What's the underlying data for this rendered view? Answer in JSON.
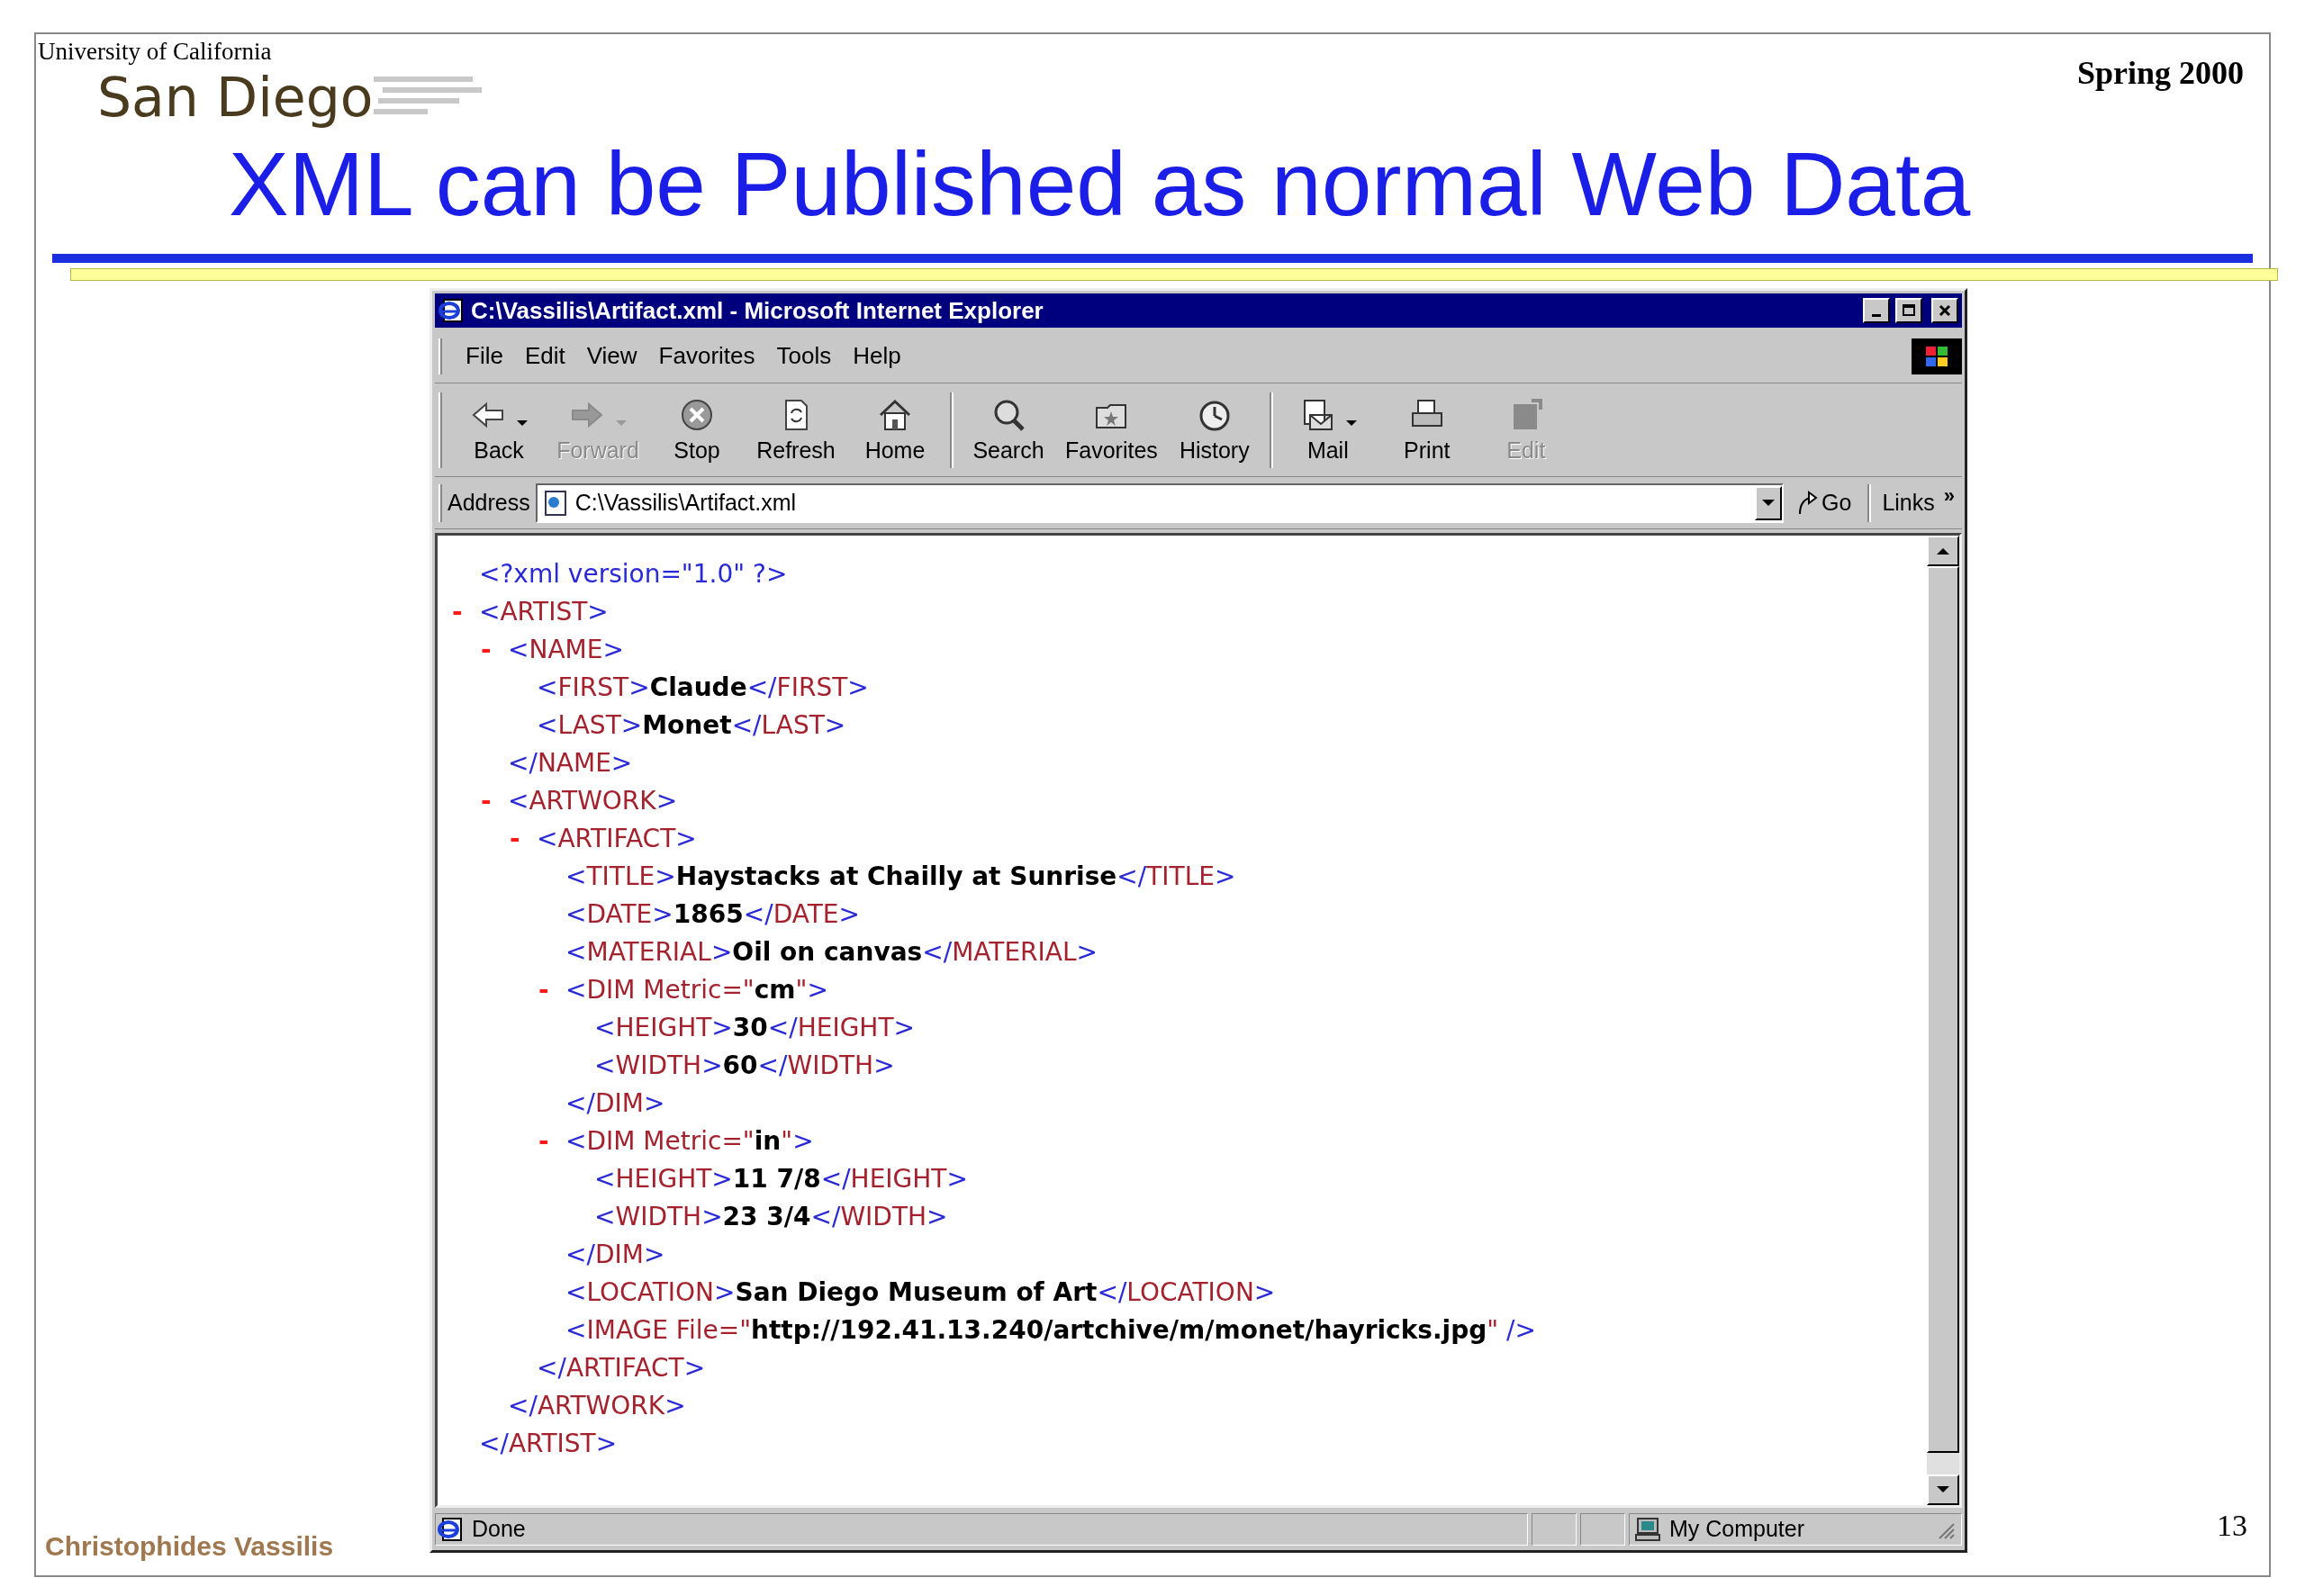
{
  "slide": {
    "institution": "University of California",
    "campus": "San Diego",
    "term": "Spring 2000",
    "title": "XML can be Published as normal Web Data",
    "author": "Christophides Vassilis",
    "page_number": "13"
  },
  "browser": {
    "title": "C:\\Vassilis\\Artifact.xml - Microsoft Internet Explorer",
    "menu": [
      "File",
      "Edit",
      "View",
      "Favorites",
      "Tools",
      "Help"
    ],
    "toolbar": [
      [
        {
          "kind": "back",
          "label": "Back",
          "disabled": false,
          "dropdown": true
        },
        {
          "kind": "forward",
          "label": "Forward",
          "disabled": true,
          "dropdown": true
        },
        {
          "kind": "stop",
          "label": "Stop",
          "disabled": false,
          "dropdown": false
        },
        {
          "kind": "refresh",
          "label": "Refresh",
          "disabled": false,
          "dropdown": false
        },
        {
          "kind": "home",
          "label": "Home",
          "disabled": false,
          "dropdown": false
        }
      ],
      [
        {
          "kind": "search",
          "label": "Search",
          "disabled": false,
          "dropdown": false
        },
        {
          "kind": "favorites",
          "label": "Favorites",
          "disabled": false,
          "dropdown": false
        },
        {
          "kind": "history",
          "label": "History",
          "disabled": false,
          "dropdown": false
        }
      ],
      [
        {
          "kind": "mail",
          "label": "Mail",
          "disabled": false,
          "dropdown": true
        },
        {
          "kind": "print",
          "label": "Print",
          "disabled": false,
          "dropdown": false
        },
        {
          "kind": "edit",
          "label": "Edit",
          "disabled": true,
          "dropdown": false
        }
      ]
    ],
    "address": {
      "label": "Address",
      "value": "C:\\Vassilis\\Artifact.xml",
      "go": "Go",
      "links": "Links",
      "links_more": "»"
    },
    "xml": [
      {
        "parts": [
          {
            "kind": "markup",
            "text": "<?xml version=\"1.0\" ?>"
          }
        ]
      },
      {
        "toggle": "-",
        "expanded": true,
        "open": [
          {
            "kind": "markup",
            "text": "<"
          },
          {
            "kind": "name",
            "text": "ARTIST"
          },
          {
            "kind": "markup",
            "text": ">"
          }
        ],
        "close": [
          {
            "kind": "markup",
            "text": "</"
          },
          {
            "kind": "name",
            "text": "ARTIST"
          },
          {
            "kind": "markup",
            "text": ">"
          }
        ],
        "children": [
          {
            "toggle": "-",
            "expanded": true,
            "open": [
              {
                "kind": "markup",
                "text": "<"
              },
              {
                "kind": "name",
                "text": "NAME"
              },
              {
                "kind": "markup",
                "text": ">"
              }
            ],
            "close": [
              {
                "kind": "markup",
                "text": "</"
              },
              {
                "kind": "name",
                "text": "NAME"
              },
              {
                "kind": "markup",
                "text": ">"
              }
            ],
            "children": [
              {
                "parts": [
                  {
                    "kind": "markup",
                    "text": "<"
                  },
                  {
                    "kind": "name",
                    "text": "FIRST"
                  },
                  {
                    "kind": "markup",
                    "text": ">"
                  },
                  {
                    "kind": "value",
                    "text": "Claude"
                  },
                  {
                    "kind": "markup",
                    "text": "</"
                  },
                  {
                    "kind": "name",
                    "text": "FIRST"
                  },
                  {
                    "kind": "markup",
                    "text": ">"
                  }
                ]
              },
              {
                "parts": [
                  {
                    "kind": "markup",
                    "text": "<"
                  },
                  {
                    "kind": "name",
                    "text": "LAST"
                  },
                  {
                    "kind": "markup",
                    "text": ">"
                  },
                  {
                    "kind": "value",
                    "text": "Monet"
                  },
                  {
                    "kind": "markup",
                    "text": "</"
                  },
                  {
                    "kind": "name",
                    "text": "LAST"
                  },
                  {
                    "kind": "markup",
                    "text": ">"
                  }
                ]
              }
            ]
          },
          {
            "toggle": "-",
            "expanded": true,
            "open": [
              {
                "kind": "markup",
                "text": "<"
              },
              {
                "kind": "name",
                "text": "ARTWORK"
              },
              {
                "kind": "markup",
                "text": ">"
              }
            ],
            "close": [
              {
                "kind": "markup",
                "text": "</"
              },
              {
                "kind": "name",
                "text": "ARTWORK"
              },
              {
                "kind": "markup",
                "text": ">"
              }
            ],
            "children": [
              {
                "toggle": "-",
                "expanded": true,
                "open": [
                  {
                    "kind": "markup",
                    "text": "<"
                  },
                  {
                    "kind": "name",
                    "text": "ARTIFACT"
                  },
                  {
                    "kind": "markup",
                    "text": ">"
                  }
                ],
                "close": [
                  {
                    "kind": "markup",
                    "text": "</"
                  },
                  {
                    "kind": "name",
                    "text": "ARTIFACT"
                  },
                  {
                    "kind": "markup",
                    "text": ">"
                  }
                ],
                "children": [
                  {
                    "parts": [
                      {
                        "kind": "markup",
                        "text": "<"
                      },
                      {
                        "kind": "name",
                        "text": "TITLE"
                      },
                      {
                        "kind": "markup",
                        "text": ">"
                      },
                      {
                        "kind": "value",
                        "text": "Haystacks at Chailly at Sunrise"
                      },
                      {
                        "kind": "markup",
                        "text": "</"
                      },
                      {
                        "kind": "name",
                        "text": "TITLE"
                      },
                      {
                        "kind": "markup",
                        "text": ">"
                      }
                    ]
                  },
                  {
                    "parts": [
                      {
                        "kind": "markup",
                        "text": "<"
                      },
                      {
                        "kind": "name",
                        "text": "DATE"
                      },
                      {
                        "kind": "markup",
                        "text": ">"
                      },
                      {
                        "kind": "value",
                        "text": "1865"
                      },
                      {
                        "kind": "markup",
                        "text": "</"
                      },
                      {
                        "kind": "name",
                        "text": "DATE"
                      },
                      {
                        "kind": "markup",
                        "text": ">"
                      }
                    ]
                  },
                  {
                    "parts": [
                      {
                        "kind": "markup",
                        "text": "<"
                      },
                      {
                        "kind": "name",
                        "text": "MATERIAL"
                      },
                      {
                        "kind": "markup",
                        "text": ">"
                      },
                      {
                        "kind": "value",
                        "text": "Oil on canvas"
                      },
                      {
                        "kind": "markup",
                        "text": "</"
                      },
                      {
                        "kind": "name",
                        "text": "MATERIAL"
                      },
                      {
                        "kind": "markup",
                        "text": ">"
                      }
                    ]
                  },
                  {
                    "toggle": "-",
                    "expanded": true,
                    "open": [
                      {
                        "kind": "markup",
                        "text": "<"
                      },
                      {
                        "kind": "name",
                        "text": "DIM Metric=\""
                      },
                      {
                        "kind": "value",
                        "text": "cm"
                      },
                      {
                        "kind": "name",
                        "text": "\""
                      },
                      {
                        "kind": "markup",
                        "text": ">"
                      }
                    ],
                    "close": [
                      {
                        "kind": "markup",
                        "text": "</"
                      },
                      {
                        "kind": "name",
                        "text": "DIM"
                      },
                      {
                        "kind": "markup",
                        "text": ">"
                      }
                    ],
                    "children": [
                      {
                        "parts": [
                          {
                            "kind": "markup",
                            "text": "<"
                          },
                          {
                            "kind": "name",
                            "text": "HEIGHT"
                          },
                          {
                            "kind": "markup",
                            "text": ">"
                          },
                          {
                            "kind": "value",
                            "text": "30"
                          },
                          {
                            "kind": "markup",
                            "text": "</"
                          },
                          {
                            "kind": "name",
                            "text": "HEIGHT"
                          },
                          {
                            "kind": "markup",
                            "text": ">"
                          }
                        ]
                      },
                      {
                        "parts": [
                          {
                            "kind": "markup",
                            "text": "<"
                          },
                          {
                            "kind": "name",
                            "text": "WIDTH"
                          },
                          {
                            "kind": "markup",
                            "text": ">"
                          },
                          {
                            "kind": "value",
                            "text": "60"
                          },
                          {
                            "kind": "markup",
                            "text": "</"
                          },
                          {
                            "kind": "name",
                            "text": "WIDTH"
                          },
                          {
                            "kind": "markup",
                            "text": ">"
                          }
                        ]
                      }
                    ]
                  },
                  {
                    "toggle": "-",
                    "expanded": true,
                    "open": [
                      {
                        "kind": "markup",
                        "text": "<"
                      },
                      {
                        "kind": "name",
                        "text": "DIM Metric=\""
                      },
                      {
                        "kind": "value",
                        "text": "in"
                      },
                      {
                        "kind": "name",
                        "text": "\""
                      },
                      {
                        "kind": "markup",
                        "text": ">"
                      }
                    ],
                    "close": [
                      {
                        "kind": "markup",
                        "text": "</"
                      },
                      {
                        "kind": "name",
                        "text": "DIM"
                      },
                      {
                        "kind": "markup",
                        "text": ">"
                      }
                    ],
                    "children": [
                      {
                        "parts": [
                          {
                            "kind": "markup",
                            "text": "<"
                          },
                          {
                            "kind": "name",
                            "text": "HEIGHT"
                          },
                          {
                            "kind": "markup",
                            "text": ">"
                          },
                          {
                            "kind": "value",
                            "text": "11 7/8"
                          },
                          {
                            "kind": "markup",
                            "text": "</"
                          },
                          {
                            "kind": "name",
                            "text": "HEIGHT"
                          },
                          {
                            "kind": "markup",
                            "text": ">"
                          }
                        ]
                      },
                      {
                        "parts": [
                          {
                            "kind": "markup",
                            "text": "<"
                          },
                          {
                            "kind": "name",
                            "text": "WIDTH"
                          },
                          {
                            "kind": "markup",
                            "text": ">"
                          },
                          {
                            "kind": "value",
                            "text": "23 3/4"
                          },
                          {
                            "kind": "markup",
                            "text": "</"
                          },
                          {
                            "kind": "name",
                            "text": "WIDTH"
                          },
                          {
                            "kind": "markup",
                            "text": ">"
                          }
                        ]
                      }
                    ]
                  },
                  {
                    "parts": [
                      {
                        "kind": "markup",
                        "text": "<"
                      },
                      {
                        "kind": "name",
                        "text": "LOCATION"
                      },
                      {
                        "kind": "markup",
                        "text": ">"
                      },
                      {
                        "kind": "value",
                        "text": "San Diego Museum of Art"
                      },
                      {
                        "kind": "markup",
                        "text": "</"
                      },
                      {
                        "kind": "name",
                        "text": "LOCATION"
                      },
                      {
                        "kind": "markup",
                        "text": ">"
                      }
                    ]
                  },
                  {
                    "parts": [
                      {
                        "kind": "markup",
                        "text": "<"
                      },
                      {
                        "kind": "name",
                        "text": "IMAGE File=\""
                      },
                      {
                        "kind": "value",
                        "text": "http://192.41.13.240/artchive/m/monet/hayricks.jpg"
                      },
                      {
                        "kind": "name",
                        "text": "\""
                      },
                      {
                        "kind": "markup",
                        "text": " />"
                      }
                    ]
                  }
                ]
              }
            ]
          }
        ]
      }
    ],
    "status": {
      "text": "Done",
      "zone": "My Computer"
    }
  }
}
